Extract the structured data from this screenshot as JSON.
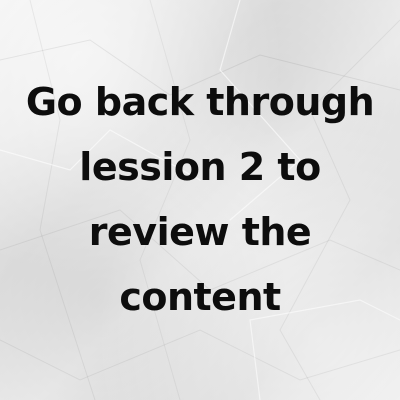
{
  "message": {
    "lines": [
      "Go back through",
      "lession 2 to",
      "review the",
      "content"
    ]
  },
  "colors": {
    "paper": "#e9e9e9",
    "text": "#0d0d0d"
  }
}
